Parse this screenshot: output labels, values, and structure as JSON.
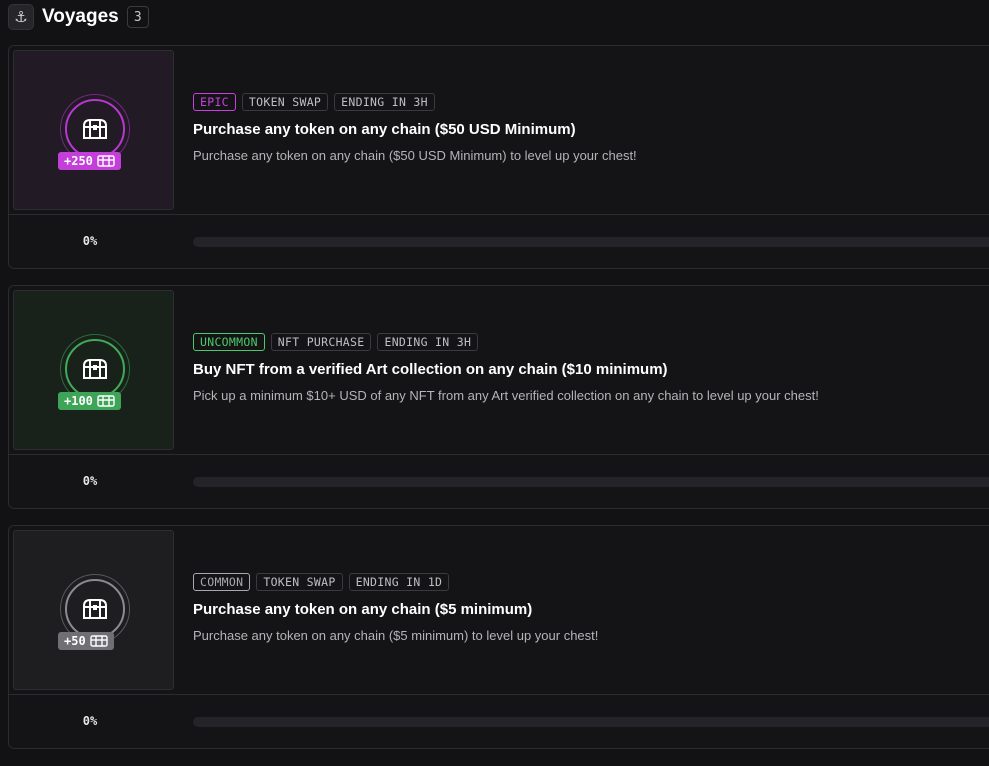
{
  "header": {
    "icon": "anchor-icon",
    "title": "Voyages",
    "count": "3"
  },
  "voyages": [
    {
      "rarity": "EPIC",
      "rarity_color": "#c93fe0",
      "type": "TOKEN SWAP",
      "ending": "ENDING IN 3H",
      "title": "Purchase any token on any chain ($50 USD Minimum)",
      "description": "Purchase any token on any chain ($50 USD Minimum) to level up your chest!",
      "reward": "+250",
      "icon": "treasure-chest-icon",
      "progress_label": "0%",
      "progress": 0,
      "thumb_bg": "#221a24",
      "ring_color": "#b638cf",
      "pill_bg": "#c43ed9"
    },
    {
      "rarity": "UNCOMMON",
      "rarity_color": "#4cc96a",
      "type": "NFT PURCHASE",
      "ending": "ENDING IN 3H",
      "title": "Buy NFT from a verified Art collection on any chain ($10 minimum)",
      "description": "Pick up a minimum $10+ USD of any NFT from any Art verified collection on any chain to level up your chest!",
      "reward": "+100",
      "icon": "treasure-chest-icon",
      "progress_label": "0%",
      "progress": 0,
      "thumb_bg": "#18221b",
      "ring_color": "#3faa58",
      "pill_bg": "#3ea558"
    },
    {
      "rarity": "COMMON",
      "rarity_color": "#a8a8ae",
      "type": "TOKEN SWAP",
      "ending": "ENDING IN 1D",
      "title": "Purchase any token on any chain ($5 minimum)",
      "description": "Purchase any token on any chain ($5 minimum) to level up your chest!",
      "reward": "+50",
      "icon": "treasure-chest-icon",
      "progress_label": "0%",
      "progress": 0,
      "thumb_bg": "#1e1e21",
      "ring_color": "#8b8b90",
      "pill_bg": "#6f6f74"
    }
  ]
}
